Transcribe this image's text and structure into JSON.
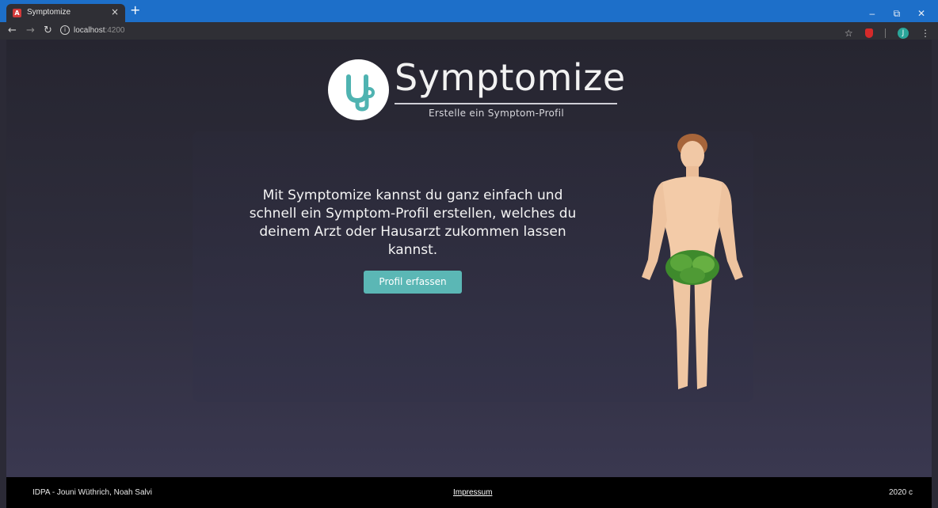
{
  "browser": {
    "tab_title": "Symptomize",
    "tab_favicon": "A",
    "tab_close": "×",
    "new_tab": "+",
    "url_host": "localhost",
    "url_port": ":4200",
    "window_controls": {
      "minimize": "–",
      "restore": "⧉",
      "close": "✕"
    },
    "profile_initial": "J",
    "accent_color": "#1d6fc9"
  },
  "header": {
    "brand_name": "Symptomize",
    "subtitle": "Erstelle ein Symptom-Profil",
    "logo_icon": "stethoscope-icon",
    "logo_color": "#4fb3b1"
  },
  "main": {
    "intro_text": "Mit Symptomize kannst du ganz einfach und schnell ein Symptom-Profil erstellen, welches du deinem Arzt oder Hausarzt zukommen lassen kannst.",
    "cta_label": "Profil erfassen",
    "cta_color": "#5bb7b5",
    "figure": "human-body-illustration"
  },
  "footer": {
    "authors": "IDPA - Jouni Wüthrich, Noah Salvi",
    "impressum": "Impressum",
    "year": "2020 c"
  }
}
